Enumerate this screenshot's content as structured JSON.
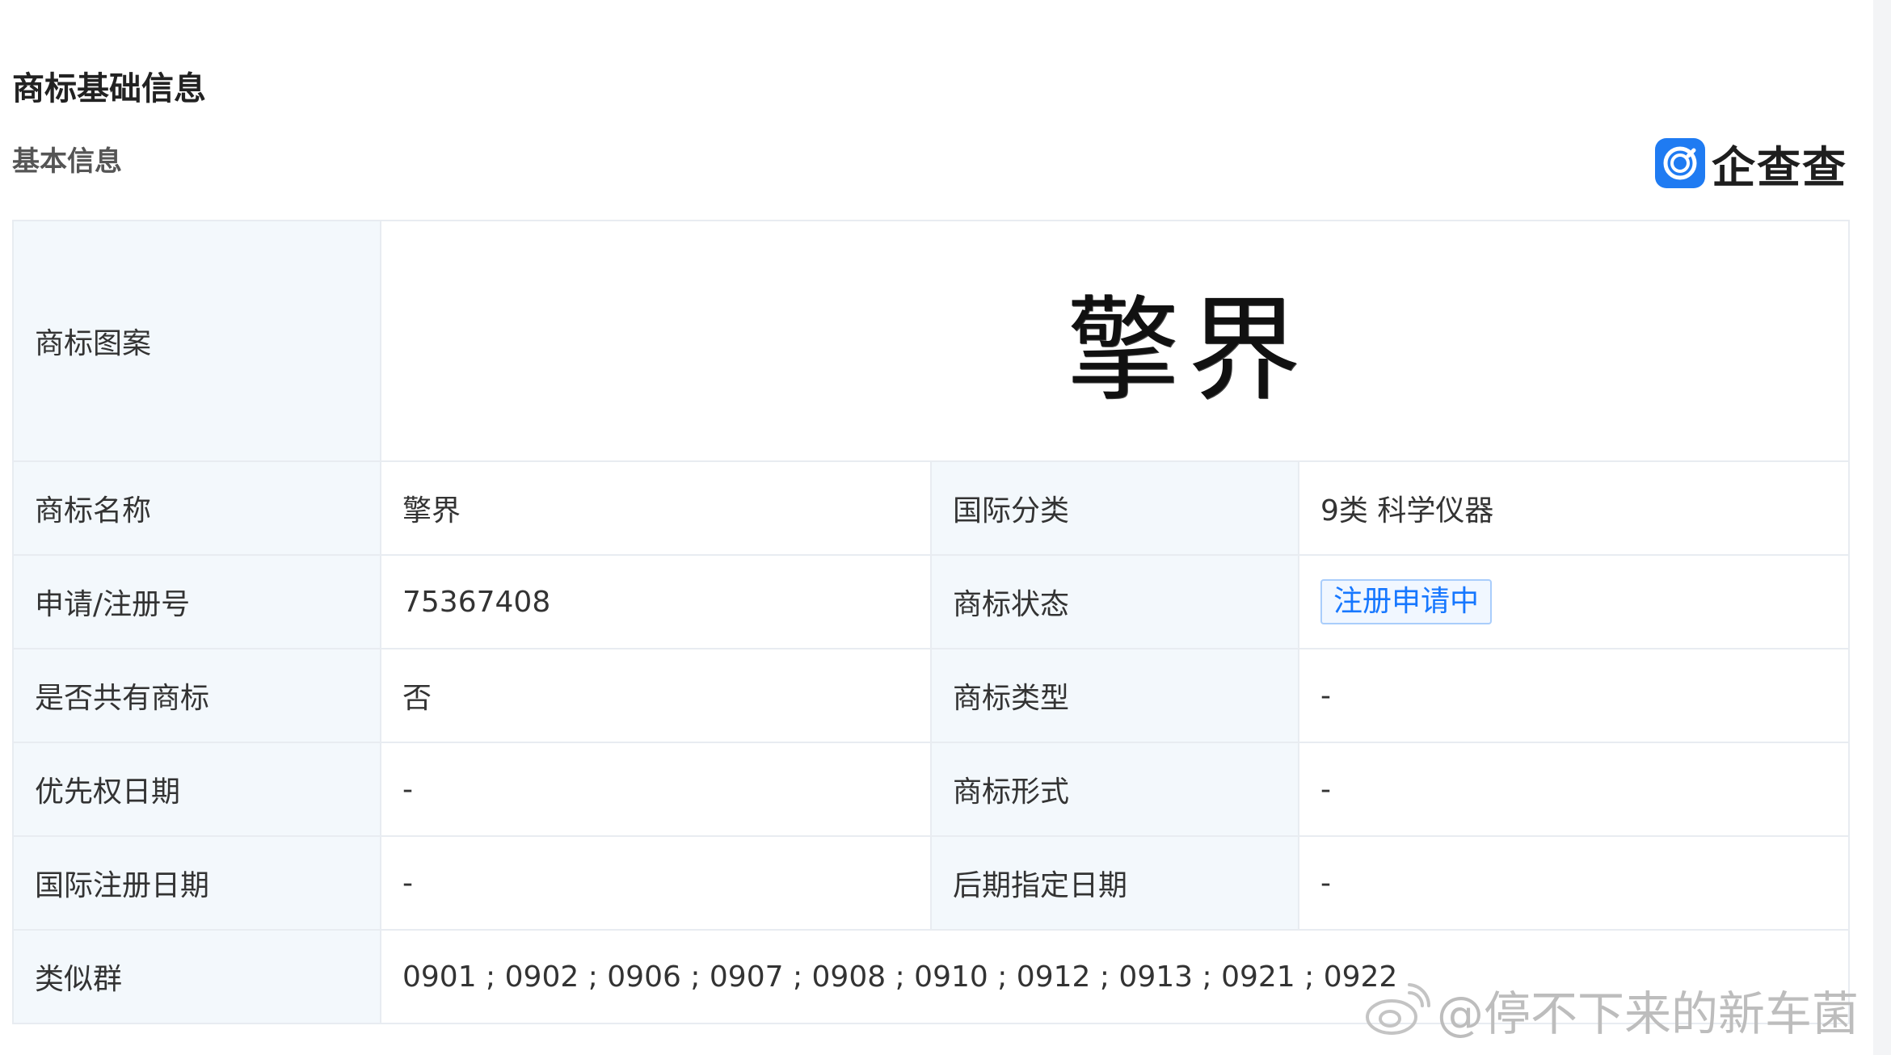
{
  "header": {
    "section_title": "商标基础信息",
    "sub_title": "基本信息"
  },
  "logo": {
    "icon": "qichacha-logo-icon",
    "text": "企查查",
    "brand_color": "#1f7bf2"
  },
  "table": {
    "image_row": {
      "label": "商标图案",
      "image_text": "擎界"
    },
    "rows": [
      {
        "label1": "商标名称",
        "value1": "擎界",
        "label2": "国际分类",
        "value2": "9类 科学仪器"
      },
      {
        "label1": "申请/注册号",
        "value1": "75367408",
        "label2": "商标状态",
        "value2": "注册申请中"
      },
      {
        "label1": "是否共有商标",
        "value1": "否",
        "label2": "商标类型",
        "value2": "-"
      },
      {
        "label1": "优先权日期",
        "value1": "-",
        "label2": "商标形式",
        "value2": "-"
      },
      {
        "label1": "国际注册日期",
        "value1": "-",
        "label2": "后期指定日期",
        "value2": "-"
      }
    ],
    "similar_group": {
      "label": "类似群",
      "value": "0901 ; 0902 ; 0906 ; 0907 ; 0908 ; 0910 ; 0912 ; 0913 ; 0921 ; 0922"
    }
  },
  "colors": {
    "label_bg": "#f3f8fc",
    "border": "#e8ecf1",
    "status_blue": "#1677ff"
  },
  "watermark": {
    "icon": "weibo-icon",
    "text": "@停不下来的新车菌"
  }
}
